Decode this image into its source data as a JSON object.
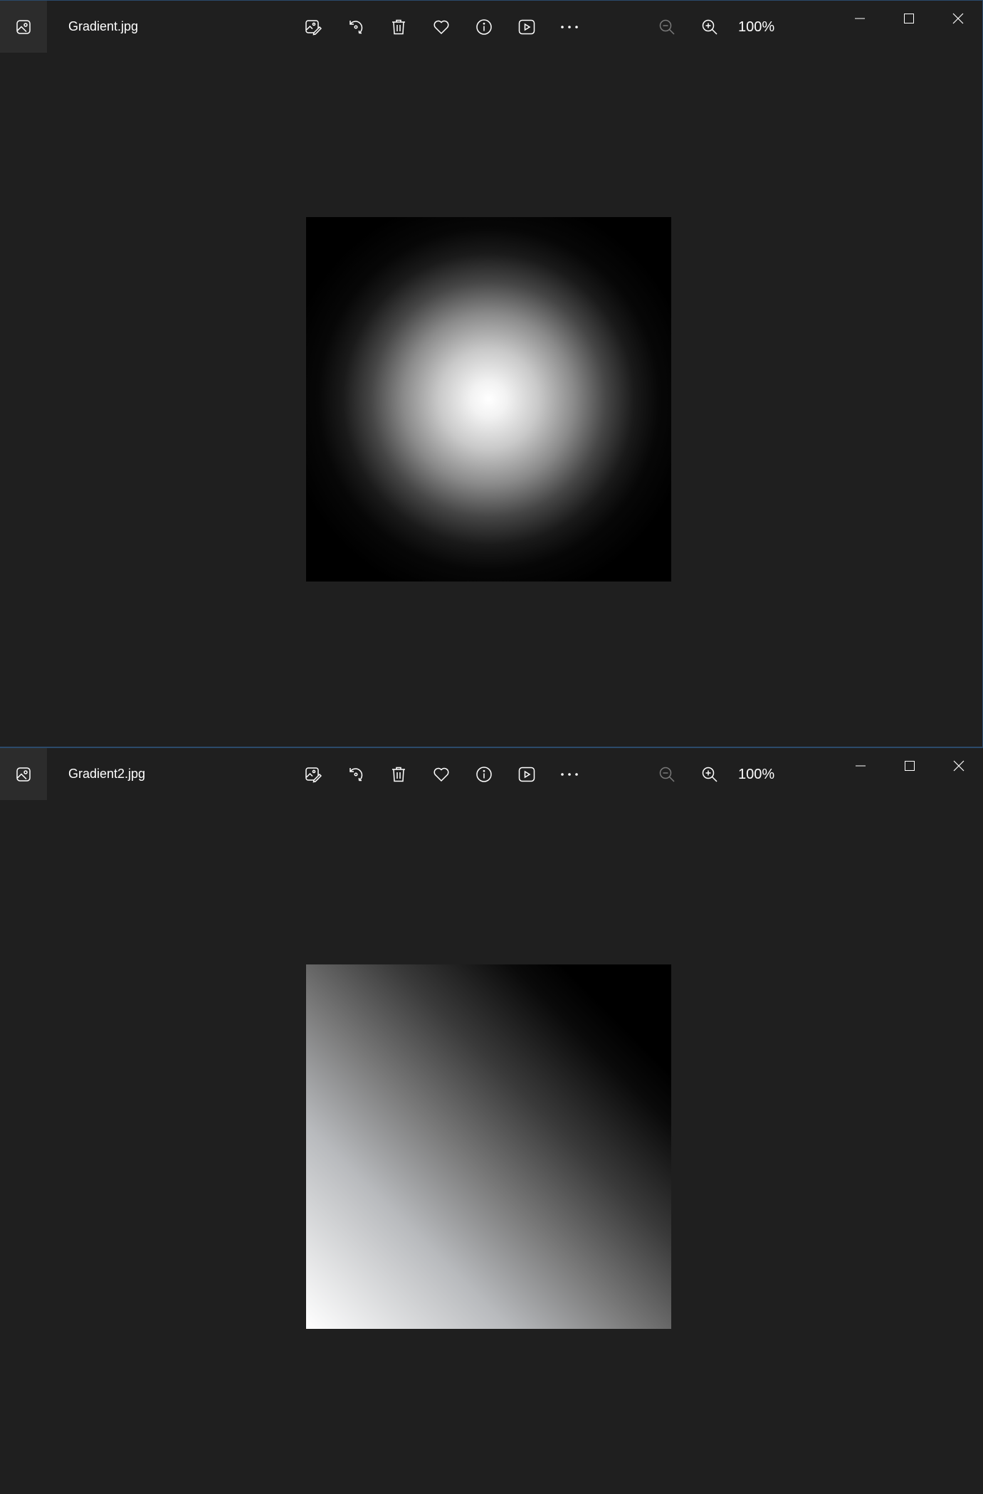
{
  "windows": [
    {
      "filename": "Gradient.jpg",
      "zoom_level": "100%",
      "image": "radial-gradient-white-center"
    },
    {
      "filename": "Gradient2.jpg",
      "zoom_level": "100%",
      "image": "diagonal-gradient-white-bottom-left"
    }
  ],
  "toolbar_icons": [
    "edit-image-icon",
    "rotate-icon",
    "delete-icon",
    "favorite-icon",
    "info-icon",
    "slideshow-icon",
    "more-icon"
  ],
  "zoom_icons": [
    "zoom-out-icon",
    "zoom-in-icon"
  ],
  "window_controls": [
    "minimize-icon",
    "maximize-icon",
    "close-icon"
  ],
  "colors": {
    "background": "#1f1f1f",
    "app_icon_bg": "#2c2c2c",
    "text": "#ffffff",
    "window_border": "#2b4a6b"
  }
}
